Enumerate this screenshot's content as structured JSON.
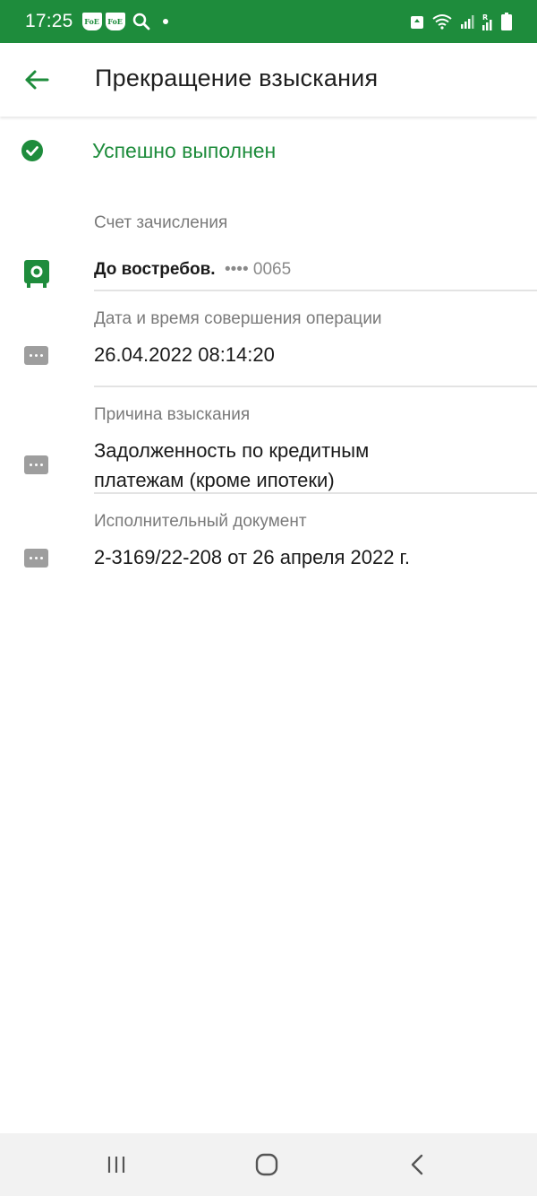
{
  "status_bar": {
    "time": "17:25",
    "app_icons": [
      "FoE",
      "FoE"
    ],
    "status_color": "#1e8c3c"
  },
  "header": {
    "title": "Прекращение взыскания",
    "accent": "#1e8c3c"
  },
  "status": {
    "text": "Успешно выполнен"
  },
  "details": {
    "account": {
      "label": "Счет зачисления",
      "name": "До востребов.",
      "mask": "•••• 0065"
    },
    "datetime": {
      "label": "Дата и время совершения операции",
      "value": "26.04.2022 08:14:20"
    },
    "reason": {
      "label": "Причина взыскания",
      "line1": "Задолженность по кредитным",
      "line2": "платежам (кроме ипотеки)"
    },
    "document": {
      "label": "Исполнительный документ",
      "value": "2-3169/22-208 от 26 апреля 2022 г."
    }
  }
}
